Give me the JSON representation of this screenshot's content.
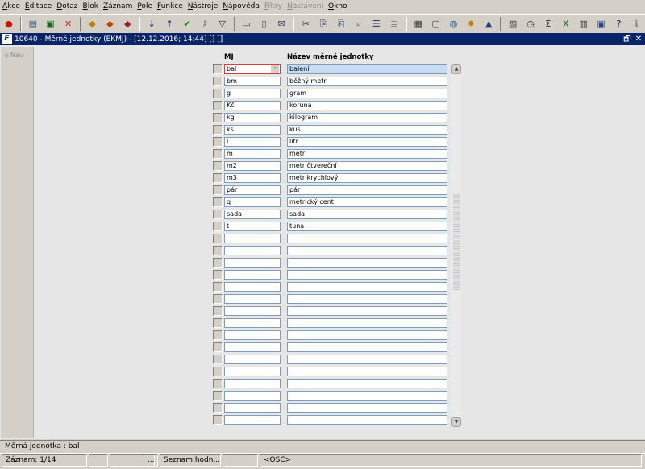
{
  "menu": [
    {
      "label": "Akce",
      "underline": "A",
      "rest": "kce",
      "enabled": true
    },
    {
      "label": "Editace",
      "underline": "E",
      "rest": "ditace",
      "enabled": true
    },
    {
      "label": "Dotaz",
      "underline": "D",
      "rest": "otaz",
      "enabled": true
    },
    {
      "label": "Blok",
      "underline": "B",
      "rest": "lok",
      "enabled": true
    },
    {
      "label": "Záznam",
      "underline": "Z",
      "rest": "áznam",
      "enabled": true
    },
    {
      "label": "Pole",
      "underline": "P",
      "rest": "ole",
      "enabled": true
    },
    {
      "label": "Funkce",
      "underline": "F",
      "rest": "unkce",
      "enabled": true
    },
    {
      "label": "Nástroje",
      "underline": "N",
      "rest": "ástroje",
      "enabled": true
    },
    {
      "label": "Nápověda",
      "underline": "N",
      "rest": "ápověda",
      "enabled": true
    },
    {
      "label": "Filtry",
      "underline": "F",
      "rest": "iltry",
      "enabled": false
    },
    {
      "label": "Nastavení",
      "underline": "N",
      "rest": "astavení",
      "enabled": false
    },
    {
      "label": "Okno",
      "underline": "O",
      "rest": "kno",
      "enabled": true
    }
  ],
  "toolbar": [
    {
      "icon": "exit-icon",
      "glyph": "●",
      "color": "#d01010"
    },
    {
      "sep": true
    },
    {
      "icon": "new-record-icon",
      "glyph": "▤",
      "color": "#406080"
    },
    {
      "icon": "save-icon",
      "glyph": "▣",
      "color": "#206020"
    },
    {
      "icon": "delete-record-icon",
      "glyph": "✕",
      "color": "#c02020"
    },
    {
      "sep": true
    },
    {
      "icon": "enter-query-icon",
      "glyph": "◆",
      "color": "#c08000"
    },
    {
      "icon": "execute-query-icon",
      "glyph": "◆",
      "color": "#c04000"
    },
    {
      "icon": "cancel-query-icon",
      "glyph": "◆",
      "color": "#a02020"
    },
    {
      "sep": true
    },
    {
      "icon": "sort-ascending-icon",
      "glyph": "↓",
      "color": "#202060"
    },
    {
      "icon": "sort-descending-icon",
      "glyph": "↑",
      "color": "#202060"
    },
    {
      "icon": "commit-icon",
      "glyph": "✔",
      "color": "#108010"
    },
    {
      "icon": "key-icon",
      "glyph": "⚷",
      "color": "#707070"
    },
    {
      "icon": "filter-icon",
      "glyph": "▽",
      "color": "#303030"
    },
    {
      "sep": true
    },
    {
      "icon": "print-icon",
      "glyph": "▭",
      "color": "#404040"
    },
    {
      "icon": "print-preview-icon",
      "glyph": "▯",
      "color": "#404040"
    },
    {
      "icon": "mail-icon",
      "glyph": "✉",
      "color": "#303060"
    },
    {
      "sep": true
    },
    {
      "icon": "cut-icon",
      "glyph": "✂",
      "color": "#202020"
    },
    {
      "icon": "copy-icon",
      "glyph": "⎘",
      "color": "#204080"
    },
    {
      "icon": "paste-icon",
      "glyph": "⎗",
      "color": "#204080"
    },
    {
      "icon": "find-icon",
      "glyph": "⌕",
      "color": "#204080"
    },
    {
      "icon": "indent-icon",
      "glyph": "☰",
      "color": "#204080"
    },
    {
      "icon": "list-icon",
      "glyph": "≣",
      "color": "#808080"
    },
    {
      "sep": true
    },
    {
      "icon": "calculator-icon",
      "glyph": "▦",
      "color": "#404040"
    },
    {
      "icon": "document-icon",
      "glyph": "▢",
      "color": "#404040"
    },
    {
      "icon": "globe-icon",
      "glyph": "◍",
      "color": "#2060a0"
    },
    {
      "icon": "star-icon",
      "glyph": "✸",
      "color": "#c08000"
    },
    {
      "icon": "triangle-icon",
      "glyph": "▲",
      "color": "#204080"
    },
    {
      "sep": true
    },
    {
      "icon": "chart-icon",
      "glyph": "▨",
      "color": "#404040"
    },
    {
      "icon": "clock-icon",
      "glyph": "◷",
      "color": "#404040"
    },
    {
      "icon": "sum-icon",
      "glyph": "Σ",
      "color": "#202020"
    },
    {
      "icon": "excel-icon",
      "glyph": "X",
      "color": "#107020"
    },
    {
      "icon": "chart-export-icon",
      "glyph": "▥",
      "color": "#404040"
    },
    {
      "icon": "help-info-icon",
      "glyph": "▣",
      "color": "#2040a0"
    },
    {
      "icon": "help-icon",
      "glyph": "?",
      "color": "#101060"
    },
    {
      "icon": "info-icon",
      "glyph": "ℹ",
      "color": "#808080"
    }
  ],
  "window": {
    "title": "10640 - Měrné jednotky (EKMJ) - [12.12.2016; 14:44]  []  []",
    "nav_label": "Nav",
    "restore_glyph": "🗗",
    "close_glyph": "✕"
  },
  "grid": {
    "header_mj": "MJ",
    "header_nazev": "Název měrné jednotky",
    "lov_glyph": "···",
    "visible_rows": 30,
    "current_index": 0,
    "records": [
      {
        "mj": "bal",
        "nazev": "balení"
      },
      {
        "mj": "bm",
        "nazev": "běžný metr"
      },
      {
        "mj": "g",
        "nazev": "gram"
      },
      {
        "mj": "Kč",
        "nazev": "koruna"
      },
      {
        "mj": "kg",
        "nazev": "kilogram"
      },
      {
        "mj": "ks",
        "nazev": "kus"
      },
      {
        "mj": "l",
        "nazev": "litr"
      },
      {
        "mj": "m",
        "nazev": "metr"
      },
      {
        "mj": "m2",
        "nazev": "metr čtvereční"
      },
      {
        "mj": "m3",
        "nazev": "metr krychlový"
      },
      {
        "mj": "pár",
        "nazev": "pár"
      },
      {
        "mj": "q",
        "nazev": "metrický cent"
      },
      {
        "mj": "sada",
        "nazev": "sada"
      },
      {
        "mj": "t",
        "nazev": "tuna"
      }
    ]
  },
  "scrollbar": {
    "up_glyph": "▲",
    "down_glyph": "▼"
  },
  "message": "Měrná jednotka : bal",
  "status": {
    "record": "Záznam: 1/14",
    "ellipsis": "...",
    "lov": "Seznam hodn...",
    "mode": "<OSC>"
  }
}
